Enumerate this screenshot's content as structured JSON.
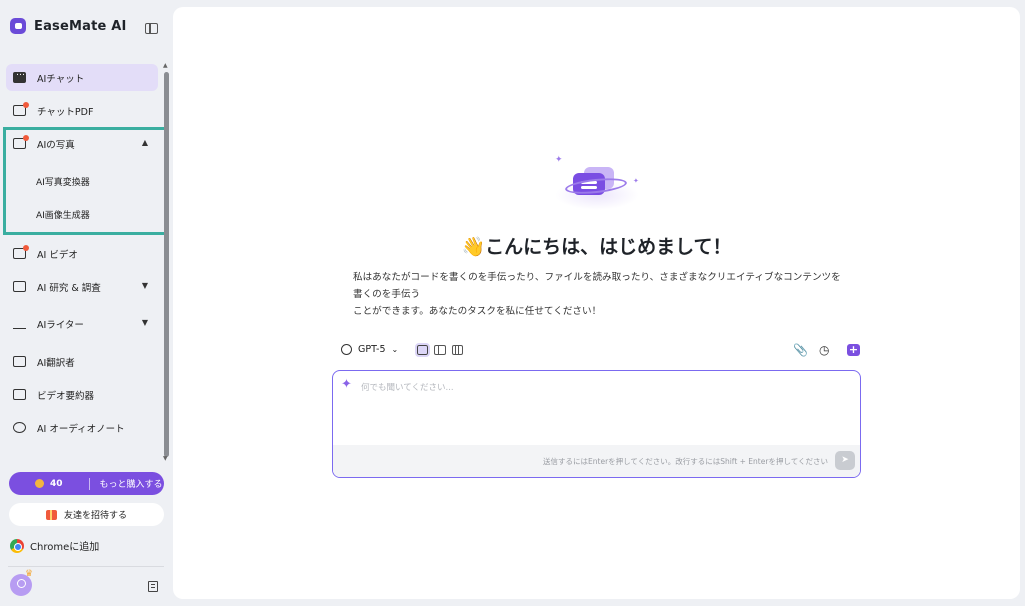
{
  "app": {
    "brand_name": "EaseMate AI"
  },
  "sidebar": {
    "items": [
      {
        "label": "AIチャット",
        "icon": "chat-icon",
        "active": true
      },
      {
        "label": "チャットPDF",
        "icon": "pdf-icon"
      },
      {
        "label": "AIの写真",
        "icon": "photo-icon",
        "expanded": true
      },
      {
        "label": "AI写真変換器",
        "sub": true
      },
      {
        "label": "AI画像生成器",
        "sub": true
      },
      {
        "label": "AI ビデオ",
        "icon": "video-icon"
      },
      {
        "label": "AI 研究 & 調査",
        "icon": "research-icon"
      },
      {
        "label": "AIライター",
        "icon": "writer-icon"
      },
      {
        "label": "AI翻訳者",
        "icon": "translate-icon"
      },
      {
        "label": "ビデオ要約器",
        "icon": "video-summary-icon"
      },
      {
        "label": "AI オーディオノート",
        "icon": "audio-note-icon"
      }
    ],
    "credits": {
      "count": "40",
      "buy_label": "もっと購入する"
    },
    "invite_label": "友達を招待する",
    "chrome_label": "Chromeに追加"
  },
  "main": {
    "greeting_emoji": "👋",
    "greeting": "こんにちは、はじめまして！",
    "description_line1": "私はあなたがコードを書くのを手伝ったり、ファイルを読み取ったり、さまざまなクリエイティブなコンテンツを書くのを手伝う",
    "description_line2": "ことができます。あなたのタスクを私に任せてください！",
    "model_label": "GPT-5",
    "input_placeholder": "何でも聞いてください...",
    "input_hint": "送信するにはEnterを押してください。改行するにはShift + Enterを押してください"
  },
  "colors": {
    "accent": "#7b4fe0",
    "highlight_box": "#3aaea0",
    "active_bg": "#e3ddf8"
  }
}
